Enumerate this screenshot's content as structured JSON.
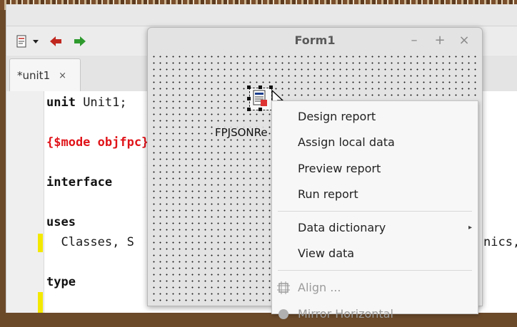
{
  "editor": {
    "tab_label": "*unit1",
    "tab_close": "×",
    "lines": {
      "l1_kw": "unit",
      "l1_rest": " Unit1;",
      "l3_directive": "{$mode objfpc}{$H+}",
      "l5_kw": "interface",
      "l7_kw": "uses",
      "l8_left": "  Classes, S",
      "l8_right": "nics,",
      "l10_kw": "type"
    }
  },
  "form": {
    "title": "Form1",
    "minimize_glyph": "–",
    "maximize_glyph": "+",
    "close_glyph": "×",
    "component_caption": "FPJSONRe"
  },
  "context_menu": {
    "items": [
      {
        "label": "Design report"
      },
      {
        "label": "Assign local data"
      },
      {
        "label": "Preview report"
      },
      {
        "label": "Run report"
      },
      {
        "label": "Data dictionary",
        "submenu_arrow": "▸"
      },
      {
        "label": "View data"
      },
      {
        "label": "Align ..."
      },
      {
        "label": "Mirror Horizontal"
      }
    ]
  },
  "colors": {
    "directive": "#e0141a",
    "modified_line_marker": "#f3e800",
    "toolbar_back_arrow": "#c0271f",
    "toolbar_forward_arrow": "#2e9a2e"
  }
}
